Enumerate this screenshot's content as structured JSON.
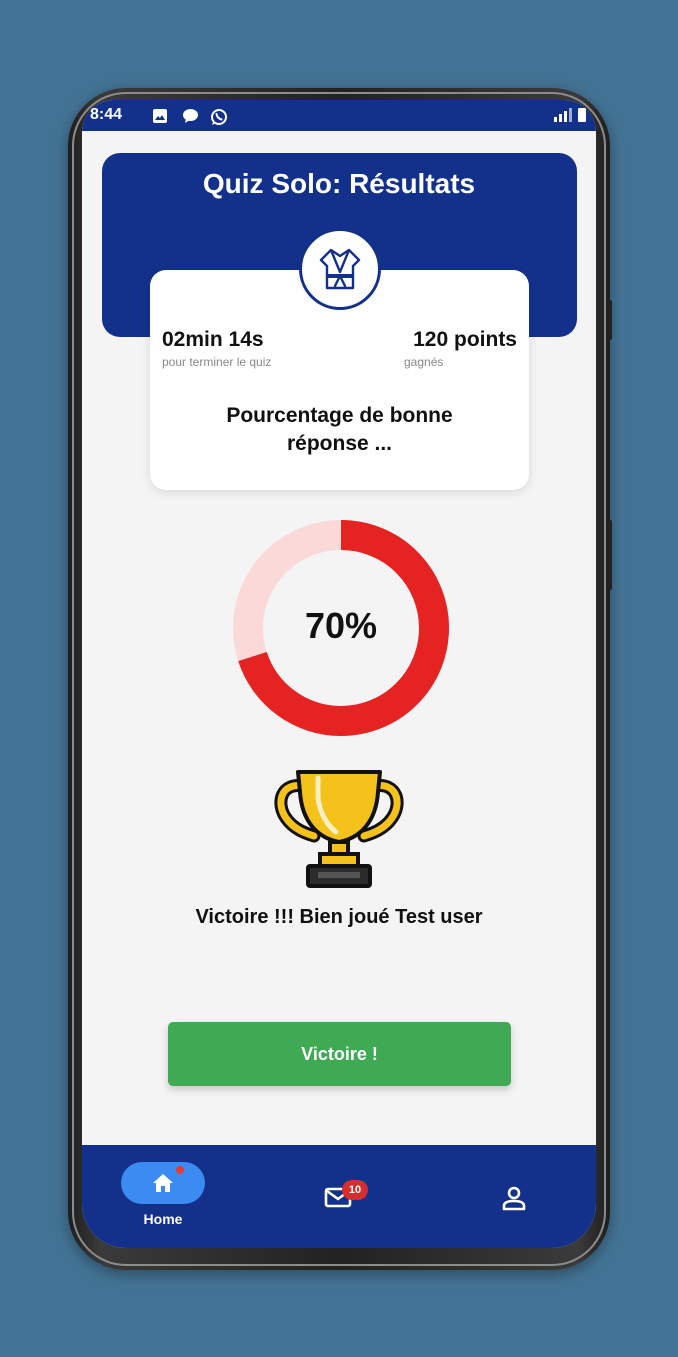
{
  "status_bar": {
    "time": "8:44"
  },
  "header": {
    "title": "Quiz Solo: Résultats"
  },
  "results": {
    "time_value": "02min 14s",
    "time_caption": "pour terminer le quiz",
    "points_value": "120 points",
    "points_caption": "gagnés",
    "percentage_label": "Pourcentage de bonne réponse ..."
  },
  "progress": {
    "percent_text": "70%",
    "fraction": 0.7,
    "color": "#e62323",
    "track_color": "#fbd9d9"
  },
  "victory": {
    "message": "Victoire !!! Bien joué Test user",
    "button_label": "Victoire !"
  },
  "bottom_nav": {
    "home_label": "Home",
    "messages_badge": "10",
    "icons": [
      "home-icon",
      "mail-icon",
      "profile-icon"
    ]
  },
  "colors": {
    "primary": "#13318a",
    "accent": "#3b8bf2",
    "success": "#3faa53",
    "background": "#437394"
  }
}
